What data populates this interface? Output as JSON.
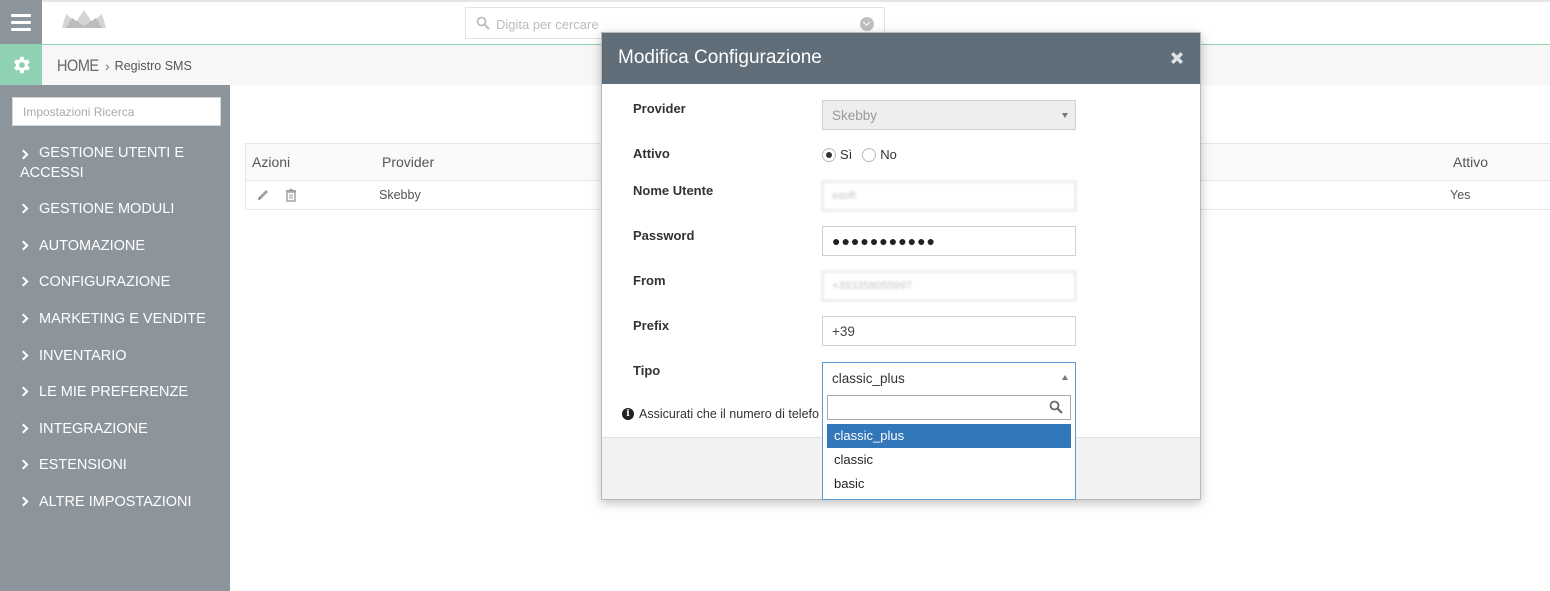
{
  "topbar": {
    "search_placeholder": "Digita per cercare"
  },
  "breadcrumb": {
    "home": "HOME",
    "separator": "›",
    "current": "Registro SMS"
  },
  "sidebar": {
    "search_placeholder": "Impostazioni Ricerca",
    "items": [
      {
        "label": "GESTIONE UTENTI E ACCESSI"
      },
      {
        "label": "GESTIONE MODULI"
      },
      {
        "label": "AUTOMAZIONE"
      },
      {
        "label": "CONFIGURAZIONE"
      },
      {
        "label": "MARKETING E VENDITE"
      },
      {
        "label": "INVENTARIO"
      },
      {
        "label": "LE MIE PREFERENZE"
      },
      {
        "label": "INTEGRAZIONE"
      },
      {
        "label": "ESTENSIONI"
      },
      {
        "label": "ALTRE IMPOSTAZIONI"
      }
    ]
  },
  "table": {
    "headers": {
      "actions": "Azioni",
      "provider": "Provider",
      "active": "Attivo"
    },
    "rows": [
      {
        "provider": "Skebby",
        "active": "Yes"
      }
    ]
  },
  "modal": {
    "title": "Modifica Configurazione",
    "fields": {
      "provider": {
        "label": "Provider",
        "value": "Skebby"
      },
      "attivo": {
        "label": "Attivo",
        "option_yes": "Sì",
        "option_no": "No",
        "selected": "Sì"
      },
      "nome_utente": {
        "label": "Nome Utente",
        "value": "esoft"
      },
      "password": {
        "label": "Password",
        "value": "●●●●●●●●●●●"
      },
      "from": {
        "label": "From",
        "value": "+393358055997"
      },
      "prefix": {
        "label": "Prefix",
        "value": "+39"
      },
      "tipo": {
        "label": "Tipo",
        "value": "classic_plus"
      }
    },
    "note": "Assicurati che il numero di telefo",
    "tipo_dropdown": {
      "options": [
        "classic_plus",
        "classic",
        "basic"
      ],
      "selected": "classic_plus"
    }
  },
  "colors": {
    "sidebar_bg": "#8d959c",
    "accent_green": "#8fd1b2",
    "modal_header": "#5f6e79",
    "dropdown_highlight": "#3177b9"
  }
}
